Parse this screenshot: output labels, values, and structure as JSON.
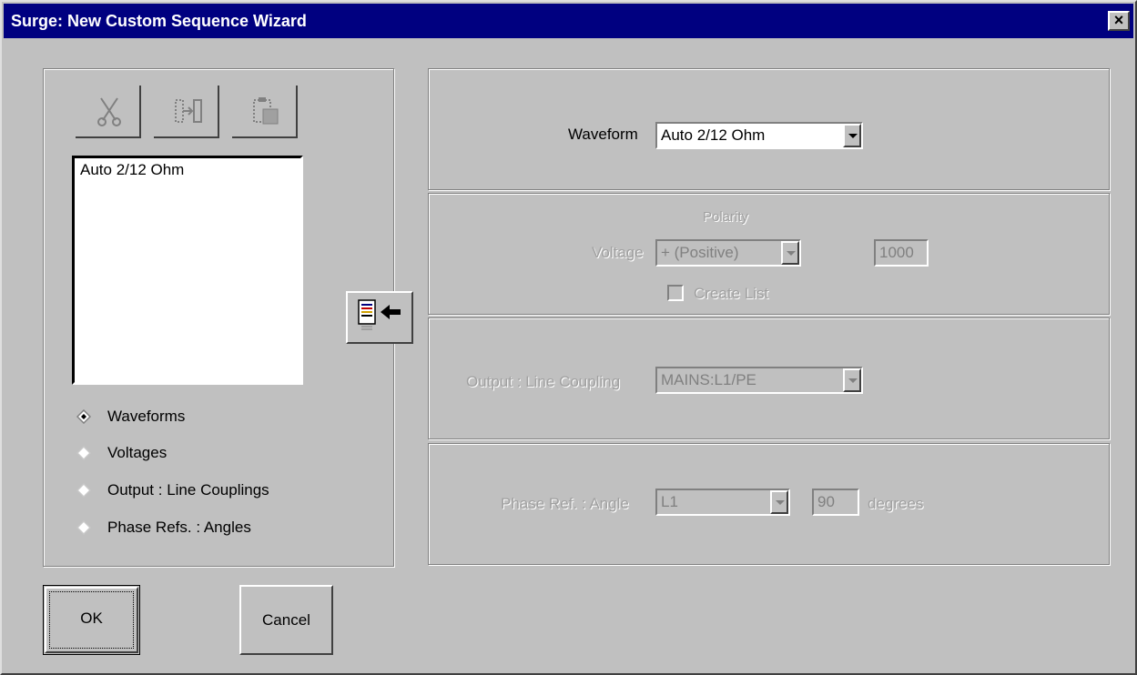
{
  "window": {
    "title": "Surge: New Custom Sequence Wizard",
    "close_glyph": "×"
  },
  "toolbar": {
    "icons": [
      "cut-icon",
      "move-icon",
      "paste-icon"
    ]
  },
  "sequence_list": {
    "items": [
      "Auto 2/12 Ohm"
    ]
  },
  "view_options": [
    {
      "label": "Waveforms",
      "selected": true
    },
    {
      "label": "Voltages",
      "selected": false
    },
    {
      "label": "Output : Line Couplings",
      "selected": false
    },
    {
      "label": "Phase Refs. : Angles",
      "selected": false
    }
  ],
  "waveform": {
    "label": "Waveform",
    "value": "Auto 2/12 Ohm"
  },
  "voltage": {
    "polarity_label": "Polarity",
    "label": "Voltage",
    "polarity_value": "+ (Positive)",
    "value": "1000",
    "create_list_label": "Create List"
  },
  "coupling": {
    "label": "Output : Line Coupling",
    "value": "MAINS:L1/PE"
  },
  "phase": {
    "label": "Phase Ref. : Angle",
    "value": "L1",
    "angle": "90",
    "unit": "degrees"
  },
  "buttons": {
    "ok": "OK",
    "cancel": "Cancel"
  },
  "colors": {
    "titlebar": "#000080",
    "face": "#c0c0c0"
  }
}
